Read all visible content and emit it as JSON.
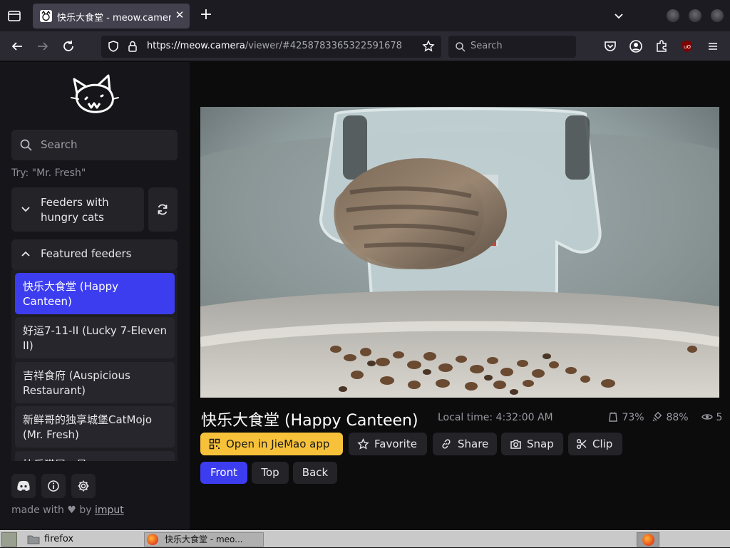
{
  "browser": {
    "tab_title": "快乐大食堂 - meow.camera",
    "url_domain": "https://meow.camera",
    "url_path": "/viewer/#4258783365322591678",
    "search_placeholder": "Search"
  },
  "sidebar": {
    "search_placeholder": "Search",
    "hint": "Try: \"Mr. Fresh\"",
    "feeders_hungry_label": "Feeders with hungry cats",
    "featured_label": "Featured feeders",
    "feeders": [
      {
        "label": "快乐大食堂 (Happy Canteen)"
      },
      {
        "label": "好运7-11-II (Lucky 7-Eleven II)"
      },
      {
        "label": "吉祥食府 (Auspicious Restaurant)"
      },
      {
        "label": "新鲜哥的独享城堡CatMojo (Mr. Fresh)"
      },
      {
        "label": "快乐猫屋一号"
      }
    ],
    "made_with_prefix": "made with",
    "made_with_by": "by",
    "made_with_author": "imput"
  },
  "main": {
    "feeder_title": "快乐大食堂 (Happy Canteen)",
    "local_time": "Local time: 4:32:00 AM",
    "stats": {
      "food": "73%",
      "signal": "88%",
      "viewers": "5"
    },
    "actions": {
      "open_app": "Open in JieMao app",
      "favorite": "Favorite",
      "share": "Share",
      "snap": "Snap",
      "clip": "Clip"
    },
    "views": [
      "Front",
      "Top",
      "Back"
    ],
    "accent_color": "#3d3df0",
    "open_app_color": "#f7c23a"
  },
  "taskbar": {
    "folder_label": "firefox",
    "window_label": "快乐大食堂 - meo..."
  }
}
